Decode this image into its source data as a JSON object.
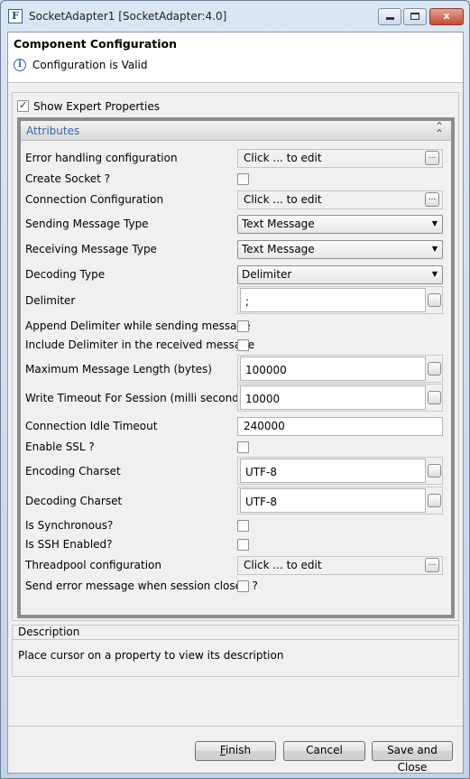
{
  "window": {
    "title": "SocketAdapter1 [SocketAdapter:4.0]",
    "app_icon_letter": "F",
    "close_glyph": "x"
  },
  "header": {
    "title": "Component Configuration",
    "status": "Configuration is Valid"
  },
  "expert": {
    "label": "Show Expert Properties",
    "checked": true
  },
  "attributes": {
    "title": "Attributes",
    "rows": [
      {
        "label": "Error handling configuration",
        "kind": "edit",
        "value": "Click ... to edit"
      },
      {
        "label": "Create Socket ?",
        "kind": "checkbox",
        "value": false
      },
      {
        "label": "Connection Configuration",
        "kind": "edit",
        "value": "Click ... to edit"
      },
      {
        "label": "Sending Message Type",
        "kind": "select",
        "value": "Text Message"
      },
      {
        "label": "Receiving Message Type",
        "kind": "select",
        "value": "Text Message"
      },
      {
        "label": "Decoding Type",
        "kind": "select",
        "value": "Delimiter"
      },
      {
        "label": "Delimiter",
        "kind": "text-btn",
        "value": ";"
      },
      {
        "label": "Append Delimiter while sending message",
        "kind": "checkbox",
        "value": false
      },
      {
        "label": "Include Delimiter in the received message",
        "kind": "checkbox",
        "value": false
      },
      {
        "label": "Maximum Message Length (bytes)",
        "kind": "text-btn",
        "value": "100000"
      },
      {
        "label": "Write Timeout For Session (milli seconds)",
        "kind": "text-btn",
        "value": "10000"
      },
      {
        "label": "Connection Idle Timeout",
        "kind": "text",
        "value": "240000"
      },
      {
        "label": "Enable SSL ?",
        "kind": "checkbox",
        "value": false
      },
      {
        "label": "Encoding Charset",
        "kind": "text-btn",
        "value": "UTF-8"
      },
      {
        "label": "Decoding Charset",
        "kind": "text-btn",
        "value": "UTF-8"
      },
      {
        "label": "Is Synchronous?",
        "kind": "checkbox",
        "value": false
      },
      {
        "label": "Is SSH Enabled?",
        "kind": "checkbox",
        "value": false
      },
      {
        "label": "Threadpool configuration",
        "kind": "edit",
        "value": "Click ... to edit"
      },
      {
        "label": "Send error message when session closed ?",
        "kind": "checkbox",
        "value": false
      }
    ]
  },
  "description": {
    "title": "Description",
    "text": "Place cursor on a property to view its description"
  },
  "buttons": {
    "finish_first": "F",
    "finish_rest": "inish",
    "cancel": "Cancel",
    "save": "Save and Close"
  }
}
